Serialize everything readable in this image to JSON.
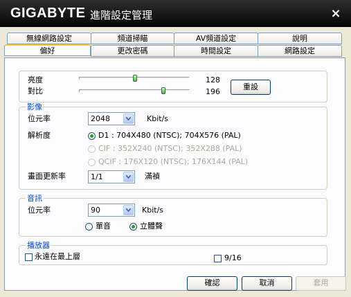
{
  "window": {
    "brand": "GIGABYTE",
    "title": "進階設定管理",
    "close_glyph": "×"
  },
  "tabs_back": [
    "無線網路設定",
    "頻道掃瞄",
    "AV頻道設定",
    "說明"
  ],
  "tabs_front": [
    "偏好",
    "更改密碼",
    "時間設定",
    "網路設定"
  ],
  "active_tab": "偏好",
  "display": {
    "brightness_label": "亮度",
    "brightness_value": "128",
    "brightness_level": 128,
    "contrast_label": "對比",
    "contrast_value": "196",
    "contrast_level": 196,
    "level_max": 255,
    "reset_label": "重設"
  },
  "video": {
    "title": "影像",
    "bitrate_label": "位元率",
    "bitrate_value": "2048",
    "bitrate_unit": "Kbit/s",
    "resolution_label": "解析度",
    "resolution_options": [
      {
        "label": "D1 :   704X480 (NTSC); 704X576 (PAL)",
        "selected": true,
        "enabled": true
      },
      {
        "label": "CIF :   352X240 (NTSC); 352X288 (PAL)",
        "selected": false,
        "enabled": false
      },
      {
        "label": "QCIF :  176X120 (NTSC); 176X144 (PAL)",
        "selected": false,
        "enabled": false
      }
    ],
    "framerate_label": "畫面更新率",
    "framerate_value": "1/1",
    "framerate_suffix": "滿禎"
  },
  "audio": {
    "title": "音訊",
    "bitrate_label": "位元率",
    "bitrate_value": "90",
    "bitrate_unit": "Kbit/s",
    "mono_label": "單音",
    "mono_selected": false,
    "stereo_label": "立體聲",
    "stereo_selected": true
  },
  "player": {
    "title": "播放器",
    "always_on_top_label": "永遠在最上層",
    "always_on_top_checked": false,
    "ratio_label": "9/16",
    "ratio_checked": false
  },
  "buttons": {
    "ok": "確認",
    "cancel": "取消",
    "apply": "套用"
  },
  "colors": {
    "group_title": "#0046d5",
    "radio_dot": "#21a121",
    "tab_highlight": "#ffc83c"
  }
}
